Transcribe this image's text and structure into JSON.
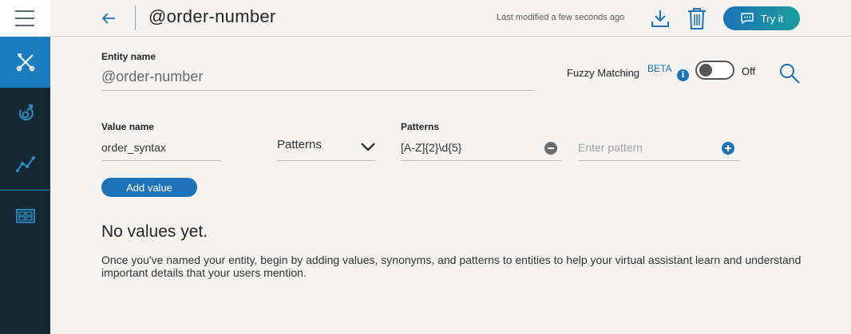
{
  "header": {
    "title": "@order-number",
    "last_modified": "Last modified a few seconds ago",
    "try_it_label": "Try it"
  },
  "sidebar": {
    "items": [
      {
        "icon": "tools-icon",
        "active": true
      },
      {
        "icon": "intent-icon",
        "active": false
      },
      {
        "icon": "analytics-icon",
        "active": false
      },
      {
        "icon": "content-catalog-icon",
        "active": false
      }
    ]
  },
  "entity": {
    "label": "Entity name",
    "value": "@order-number"
  },
  "fuzzy": {
    "label": "Fuzzy Matching",
    "beta": "BETA",
    "info": "i",
    "state": "Off"
  },
  "value_row": {
    "value_name_label": "Value name",
    "value_name": "order_syntax",
    "type_selected": "Patterns",
    "patterns_label": "Patterns",
    "pattern_1": "[A-Z]{2}\\d{5}",
    "pattern_placeholder": "Enter pattern"
  },
  "add_value_label": "Add value",
  "empty_state": {
    "title": "No values yet.",
    "description": "Once you've named your entity, begin by adding values, synonyms, and patterns to entities to help your virtual assistant learn and understand important details that your users mention."
  },
  "colors": {
    "accent": "#1d72b8",
    "sidebar_bg": "#152935",
    "sidebar_active": "#1b7cc1",
    "try_it_gradient_end": "#1a9d9d",
    "page_bg": "#f4f3f1"
  }
}
